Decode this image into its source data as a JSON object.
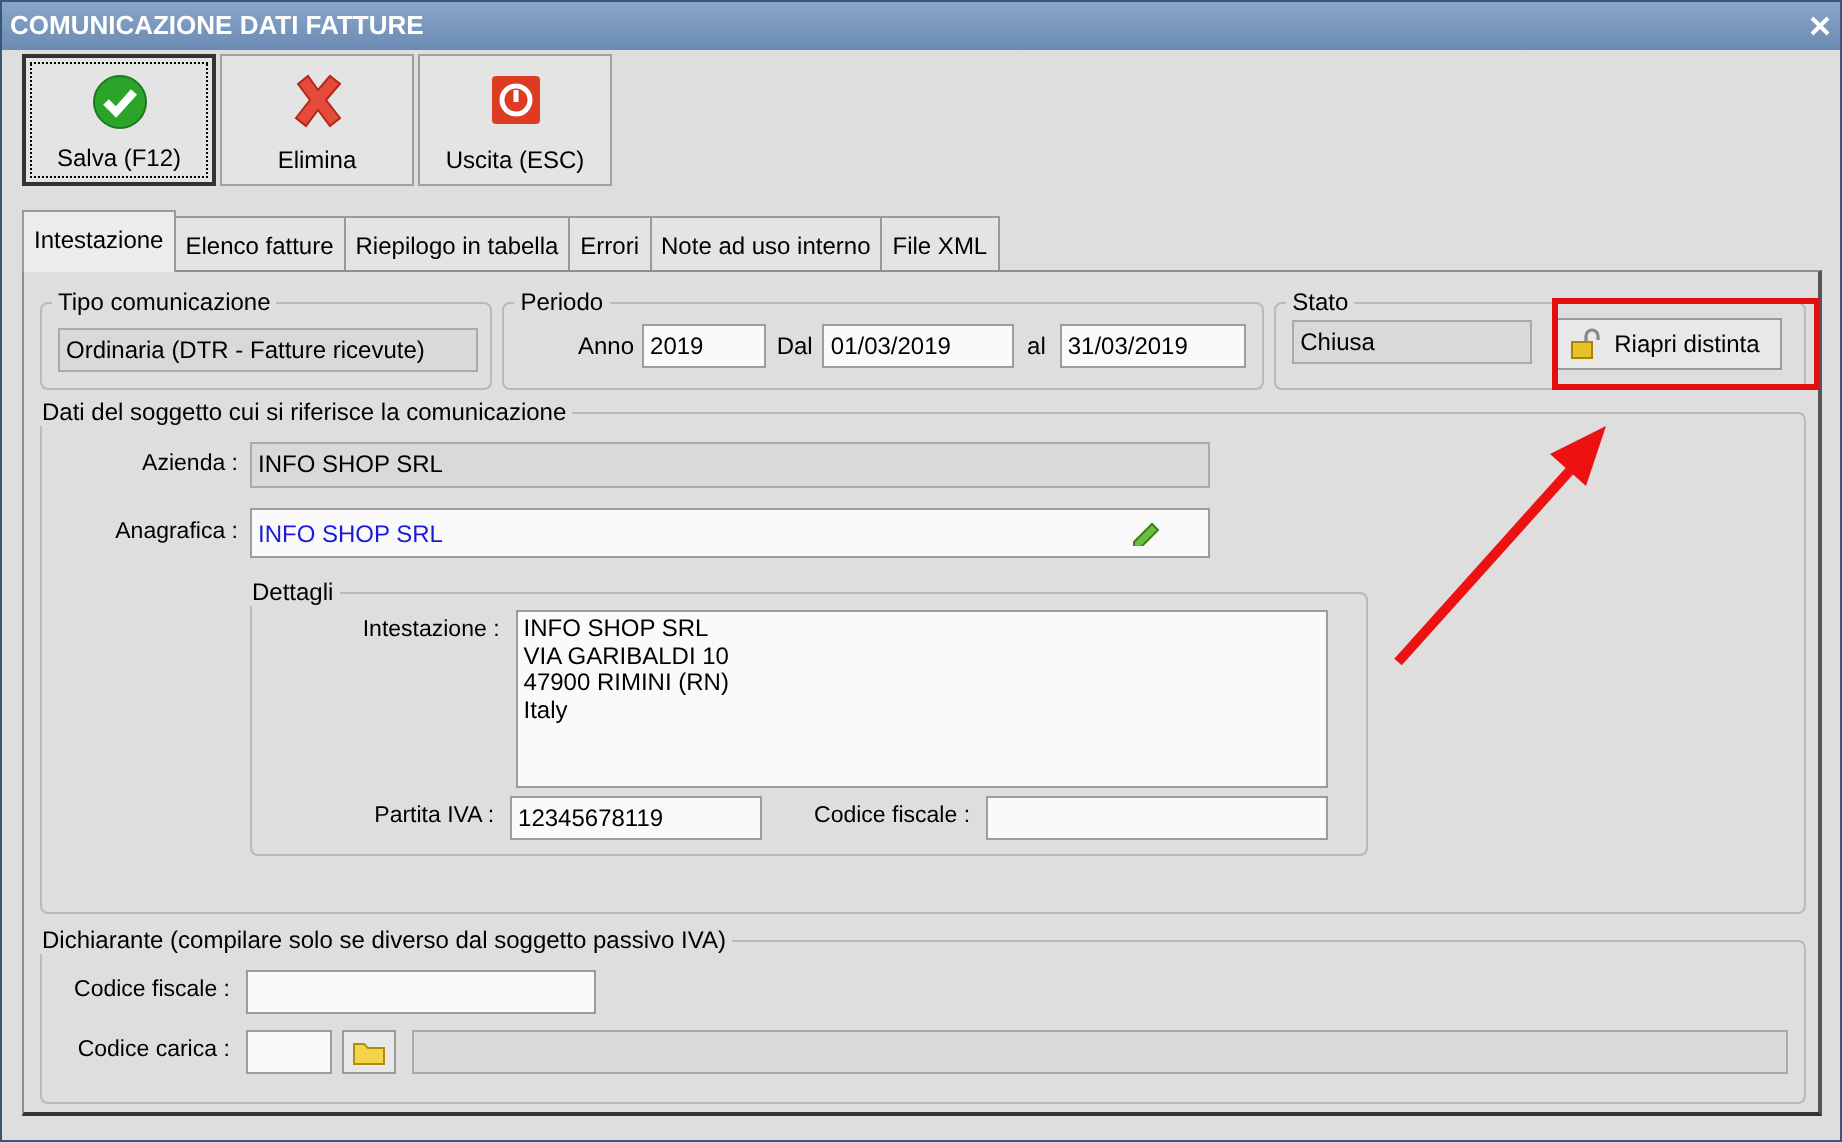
{
  "window": {
    "title": "COMUNICAZIONE DATI FATTURE"
  },
  "toolbar": [
    {
      "label": "Salva (F12)",
      "kind": "save",
      "focused": true
    },
    {
      "label": "Elimina",
      "kind": "delete",
      "focused": false
    },
    {
      "label": "Uscita (ESC)",
      "kind": "exit",
      "focused": false
    }
  ],
  "tabs": [
    {
      "label": "Intestazione",
      "selected": true
    },
    {
      "label": "Elenco fatture",
      "selected": false
    },
    {
      "label": "Riepilogo in tabella",
      "selected": false
    },
    {
      "label": "Errori",
      "selected": false
    },
    {
      "label": "Note ad uso interno",
      "selected": false
    },
    {
      "label": "File XML",
      "selected": false
    }
  ],
  "tipo_comunicazione": {
    "legend": "Tipo comunicazione",
    "value": "Ordinaria (DTR - Fatture ricevute)"
  },
  "periodo": {
    "legend": "Periodo",
    "fields": [
      {
        "label": "Anno",
        "value": "2019"
      },
      {
        "label": "Dal",
        "value": "01/03/2019"
      },
      {
        "label": "al",
        "value": "31/03/2019"
      }
    ]
  },
  "stato": {
    "legend": "Stato",
    "value": "Chiusa",
    "button": "Riapri distinta",
    "highlighted": true
  },
  "soggetto": {
    "legend": "Dati del soggetto cui si riferisce la comunicazione",
    "azienda": {
      "label": "Azienda :",
      "value": "INFO SHOP SRL"
    },
    "anagrafica": {
      "label": "Anagrafica :",
      "value": "INFO SHOP SRL"
    },
    "dettagli": {
      "legend": "Dettagli",
      "intestazione": {
        "label": "Intestazione :",
        "lines": [
          "INFO SHOP SRL",
          "VIA GARIBALDI 10",
          "47900 RIMINI (RN)",
          "Italy"
        ]
      },
      "partita_iva": {
        "label": "Partita IVA :",
        "value": "12345678119"
      },
      "codice_fiscale": {
        "label": "Codice fiscale :"
      }
    }
  },
  "dichiarante": {
    "legend": "Dichiarante (compilare solo se diverso dal soggetto passivo IVA)",
    "codice_fiscale": {
      "label": "Codice fiscale :"
    },
    "codice_carica": {
      "label": "Codice carica :"
    }
  }
}
